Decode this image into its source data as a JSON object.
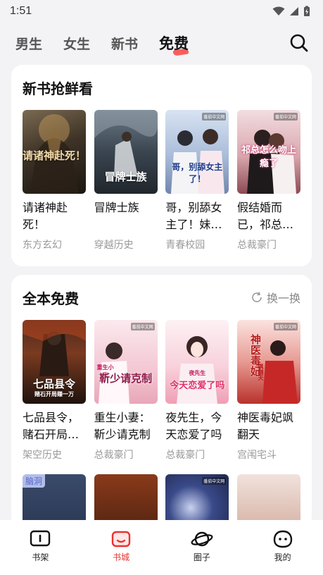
{
  "status_bar": {
    "time": "1:51"
  },
  "top_tabs": [
    "男生",
    "女生",
    "新书",
    "免费"
  ],
  "active_tab": "免费",
  "section1": {
    "title": "新书抢鲜看",
    "books": [
      {
        "name": "请诸神赴死！",
        "tag": "东方玄幻",
        "cover_text": "请诸神赴死！",
        "publisher": ""
      },
      {
        "name": "冒牌士族",
        "tag": "穿越历史",
        "cover_text": "冒牌士族",
        "publisher": ""
      },
      {
        "name": "哥，别舔女主了！妹…",
        "tag": "青春校园",
        "cover_text": "哥，别舔女主了！",
        "publisher": "番茄中文网"
      },
      {
        "name": "假结婚而已，祁总…",
        "tag": "总裁豪门",
        "cover_text": "祁总怎么吻上瘾了",
        "publisher": "番茄中文网"
      }
    ]
  },
  "section2": {
    "title": "全本免费",
    "refresh_label": "换一换",
    "books": [
      {
        "name": "七品县令，赌石开局…",
        "tag": "架空历史",
        "cover_text": "七品县令",
        "cover_sub": "赌石开局赚一万",
        "publisher": ""
      },
      {
        "name": "重生小妻：靳少请克制",
        "tag": "总裁豪门",
        "cover_text": "靳少请克制",
        "cover_sub": "重生小妻",
        "publisher": "番茄中文网"
      },
      {
        "name": "夜先生，今天恋爱了吗",
        "tag": "总裁豪门",
        "cover_text": "今天恋爱了吗",
        "cover_sub": "夜先生",
        "publisher": ""
      },
      {
        "name": "神医毒妃飒翻天",
        "tag": "宫闱宅斗",
        "cover_text": "神医毒妃",
        "cover_sub": "飒翻天",
        "publisher": "番茄中文网"
      }
    ],
    "row2_badge": "脑洞",
    "row2_publisher": "番茄中文网"
  },
  "bottom_nav": [
    {
      "label": "书架",
      "icon": "bookshelf-icon"
    },
    {
      "label": "书城",
      "icon": "bookstore-icon"
    },
    {
      "label": "圈子",
      "icon": "planet-icon"
    },
    {
      "label": "我的",
      "icon": "profile-icon"
    }
  ],
  "colors": {
    "accent": "#e8332f",
    "tag": "#999999"
  }
}
